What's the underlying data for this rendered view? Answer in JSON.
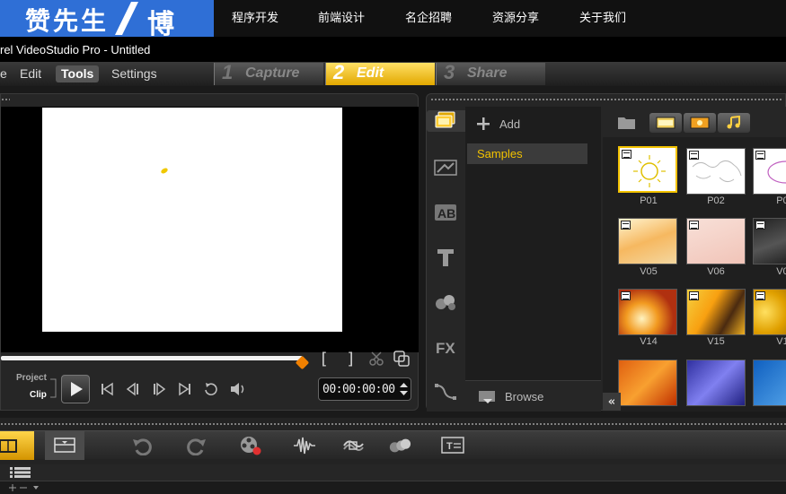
{
  "banner": {
    "logo_text": "赞先生",
    "logo_sub": "博",
    "nav": [
      "程序开发",
      "前端设计",
      "名企招聘",
      "资源分享",
      "关于我们"
    ]
  },
  "window": {
    "title": "rel VideoStudio Pro - Untitled"
  },
  "menu": {
    "items": [
      "e",
      "Edit",
      "Tools",
      "Settings"
    ],
    "active": "Tools"
  },
  "steps": [
    {
      "num": "1",
      "label": "Capture",
      "active": false
    },
    {
      "num": "2",
      "label": "Edit",
      "active": true
    },
    {
      "num": "3",
      "label": "Share",
      "active": false
    }
  ],
  "preview": {
    "mode_project": "Project",
    "mode_clip": "Clip",
    "timecode": "00:00:00:00",
    "scrub_position": 1.0
  },
  "library": {
    "add_label": "Add",
    "folders": [
      "Samples"
    ],
    "selected_folder": "Samples",
    "browse_label": "Browse",
    "thumbnails": [
      [
        "P01",
        "P02",
        "P0"
      ],
      [
        "V05",
        "V06",
        "V0"
      ],
      [
        "V14",
        "V15",
        "V1"
      ],
      [
        "",
        "",
        ""
      ]
    ],
    "selected_thumbnail": "P01"
  },
  "colors": {
    "accent_yellow": "#f2c200",
    "step_active": "#e2a800",
    "banner_blue": "#2f6fd6",
    "scrub_handle": "#f08000"
  }
}
